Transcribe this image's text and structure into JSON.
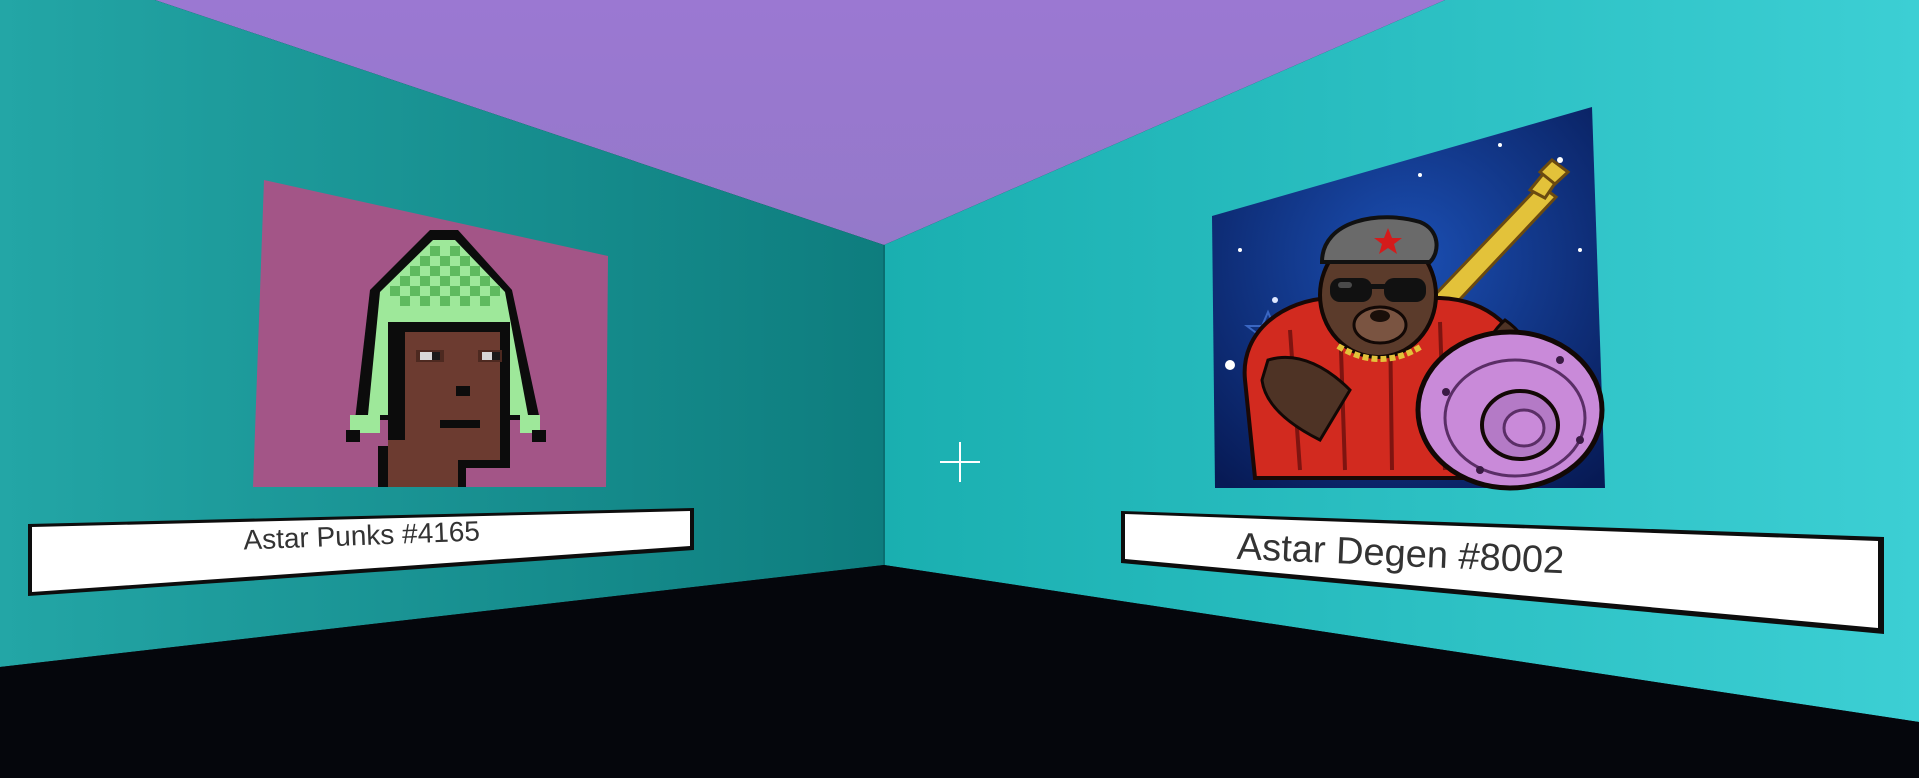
{
  "gallery": {
    "exhibits": [
      {
        "title": "Astar Punks #4165",
        "artwork_icon": "pixel-punk-portrait"
      },
      {
        "title": "Astar Degen #8002",
        "artwork_icon": "armored-bear-warrior"
      }
    ]
  },
  "colors": {
    "ceiling": "#9878cf",
    "left_wall_far": "#0f8080",
    "left_wall_near": "#21a3a3",
    "right_wall_far": "#1bb0b0",
    "right_wall_near": "#3bd0d4",
    "floor": "#05060c",
    "punk_background": "#a35587",
    "degen_background": "#0c2d7a",
    "label_panel": "#ffffff"
  },
  "hud": {
    "crosshair_icon": "crosshair-icon"
  }
}
